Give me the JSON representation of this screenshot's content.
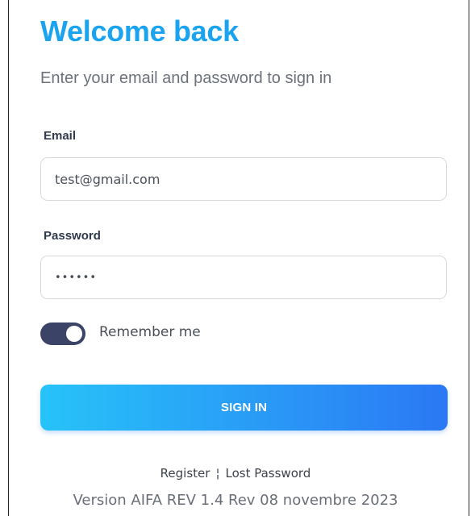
{
  "header": {
    "title": "Welcome back",
    "subtitle": "Enter your email and password to sign in"
  },
  "form": {
    "email_label": "Email",
    "email_value": "test@gmail.com",
    "password_label": "Password",
    "password_value": "••••••",
    "remember_label": "Remember me",
    "remember_checked": true,
    "signin_label": "SIGN IN"
  },
  "footer": {
    "register_label": "Register",
    "separator": "¦",
    "lost_password_label": "Lost Password",
    "version": "Version AIFA REV 1.4 Rev 08 novembre 2023"
  },
  "colors": {
    "title": "#1aa3ee",
    "button_start": "#27c3f9",
    "button_end": "#2b78f4",
    "toggle_on": "#3b4466"
  }
}
